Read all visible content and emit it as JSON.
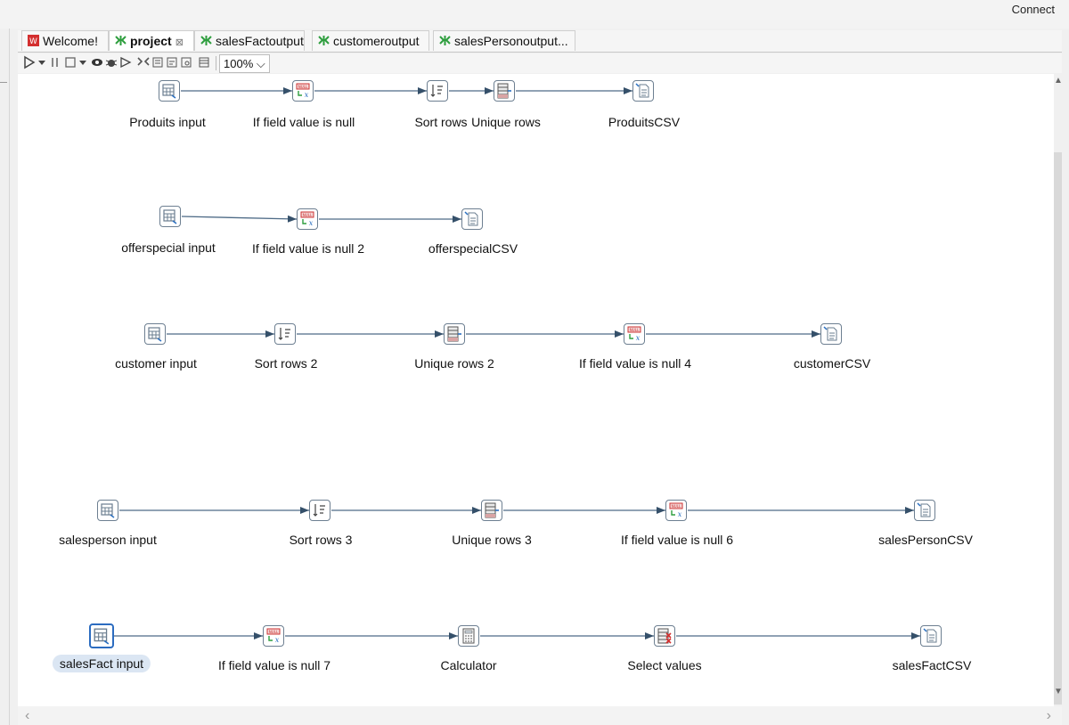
{
  "window": {
    "connect_label": "Connect"
  },
  "tabs": [
    {
      "label": "Welcome!",
      "icon": "welcome-icon"
    },
    {
      "label": "project",
      "icon": "transformation-icon",
      "active": true,
      "close": "⊠"
    },
    {
      "label": "salesFactoutput",
      "icon": "transformation-icon"
    },
    {
      "label": "customeroutput",
      "icon": "transformation-icon"
    },
    {
      "label": "salesPersonoutput...",
      "icon": "transformation-icon"
    }
  ],
  "toolbar": {
    "zoom": "100%"
  },
  "steps": {
    "produits_input": "Produits input",
    "ifnull_1": "If field value is null",
    "sort_rows": "Sort rows",
    "unique_rows": "Unique rows",
    "produits_csv": "ProduitsCSV",
    "offerspecial_input": "offerspecial input",
    "ifnull_2": "If field value is null 2",
    "offerspecial_csv": "offerspecialCSV",
    "customer_input": "customer input",
    "sort_rows_2": "Sort rows 2",
    "unique_rows_2": "Unique rows 2",
    "ifnull_4": "If field value is null 4",
    "customer_csv": "customerCSV",
    "salesperson_input": "salesperson input",
    "sort_rows_3": "Sort rows 3",
    "unique_rows_3": "Unique rows 3",
    "ifnull_6": "If field value is null 6",
    "salesperson_csv": "salesPersonCSV",
    "salesfact_input": "salesFact input",
    "ifnull_7": "If field value is null 7",
    "calculator": "Calculator",
    "select_values": "Select values",
    "salesfact_csv": "salesFactCSV"
  }
}
